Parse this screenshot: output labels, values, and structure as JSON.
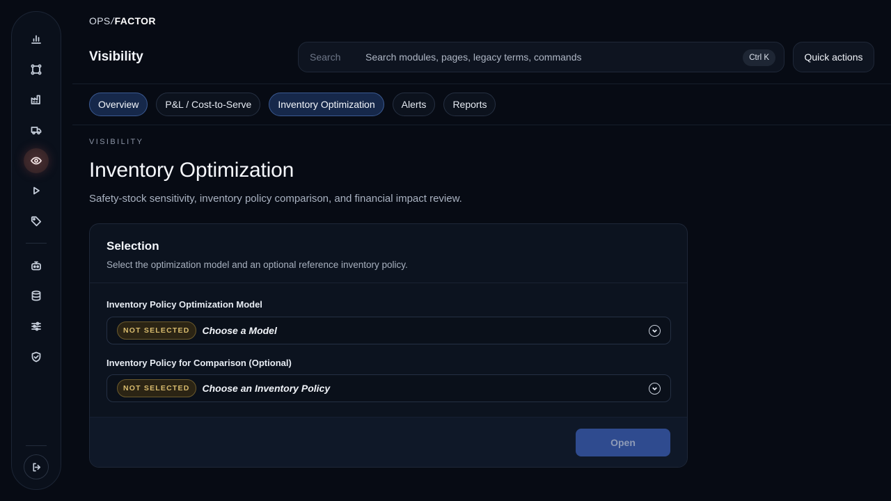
{
  "brand": {
    "ops": "OPS",
    "slash": "/",
    "factor": "FACTOR"
  },
  "header": {
    "section_title": "Visibility",
    "search": {
      "label": "Search",
      "placeholder": "Search modules, pages, legacy terms, commands",
      "shortcut": "Ctrl K"
    },
    "quick_actions_label": "Quick actions"
  },
  "sidebar": {
    "items": [
      {
        "icon": "bar-chart-icon",
        "active": false
      },
      {
        "icon": "network-nodes-icon",
        "active": false
      },
      {
        "icon": "factory-icon",
        "active": false
      },
      {
        "icon": "truck-icon",
        "active": false
      },
      {
        "icon": "eye-icon",
        "active": true
      },
      {
        "icon": "play-icon",
        "active": false
      },
      {
        "icon": "tag-icon",
        "active": false
      },
      {
        "icon": "bot-icon",
        "active": false
      },
      {
        "icon": "database-icon",
        "active": false
      },
      {
        "icon": "sliders-icon",
        "active": false
      },
      {
        "icon": "shield-check-icon",
        "active": false
      }
    ],
    "logout_icon": "logout-icon"
  },
  "tabs": [
    {
      "label": "Overview",
      "selected": true
    },
    {
      "label": "P&L / Cost-to-Serve",
      "selected": false
    },
    {
      "label": "Inventory Optimization",
      "selected": true
    },
    {
      "label": "Alerts",
      "selected": false
    },
    {
      "label": "Reports",
      "selected": false
    }
  ],
  "page": {
    "eyebrow": "VISIBILITY",
    "title": "Inventory Optimization",
    "subtitle": "Safety-stock sensitivity, inventory policy comparison, and financial impact review."
  },
  "selection": {
    "title": "Selection",
    "description": "Select the optimization model and an optional reference inventory policy.",
    "fields": [
      {
        "label": "Inventory Policy Optimization Model",
        "badge": "NOT SELECTED",
        "value": "Choose a Model"
      },
      {
        "label": "Inventory Policy for Comparison (Optional)",
        "badge": "NOT SELECTED",
        "value": "Choose an Inventory Policy"
      }
    ],
    "open_label": "Open"
  },
  "colors": {
    "background": "#070b14",
    "accent": "#2f4b8f",
    "selected_tab": "#16284a",
    "badge": "#d9bc6e"
  }
}
